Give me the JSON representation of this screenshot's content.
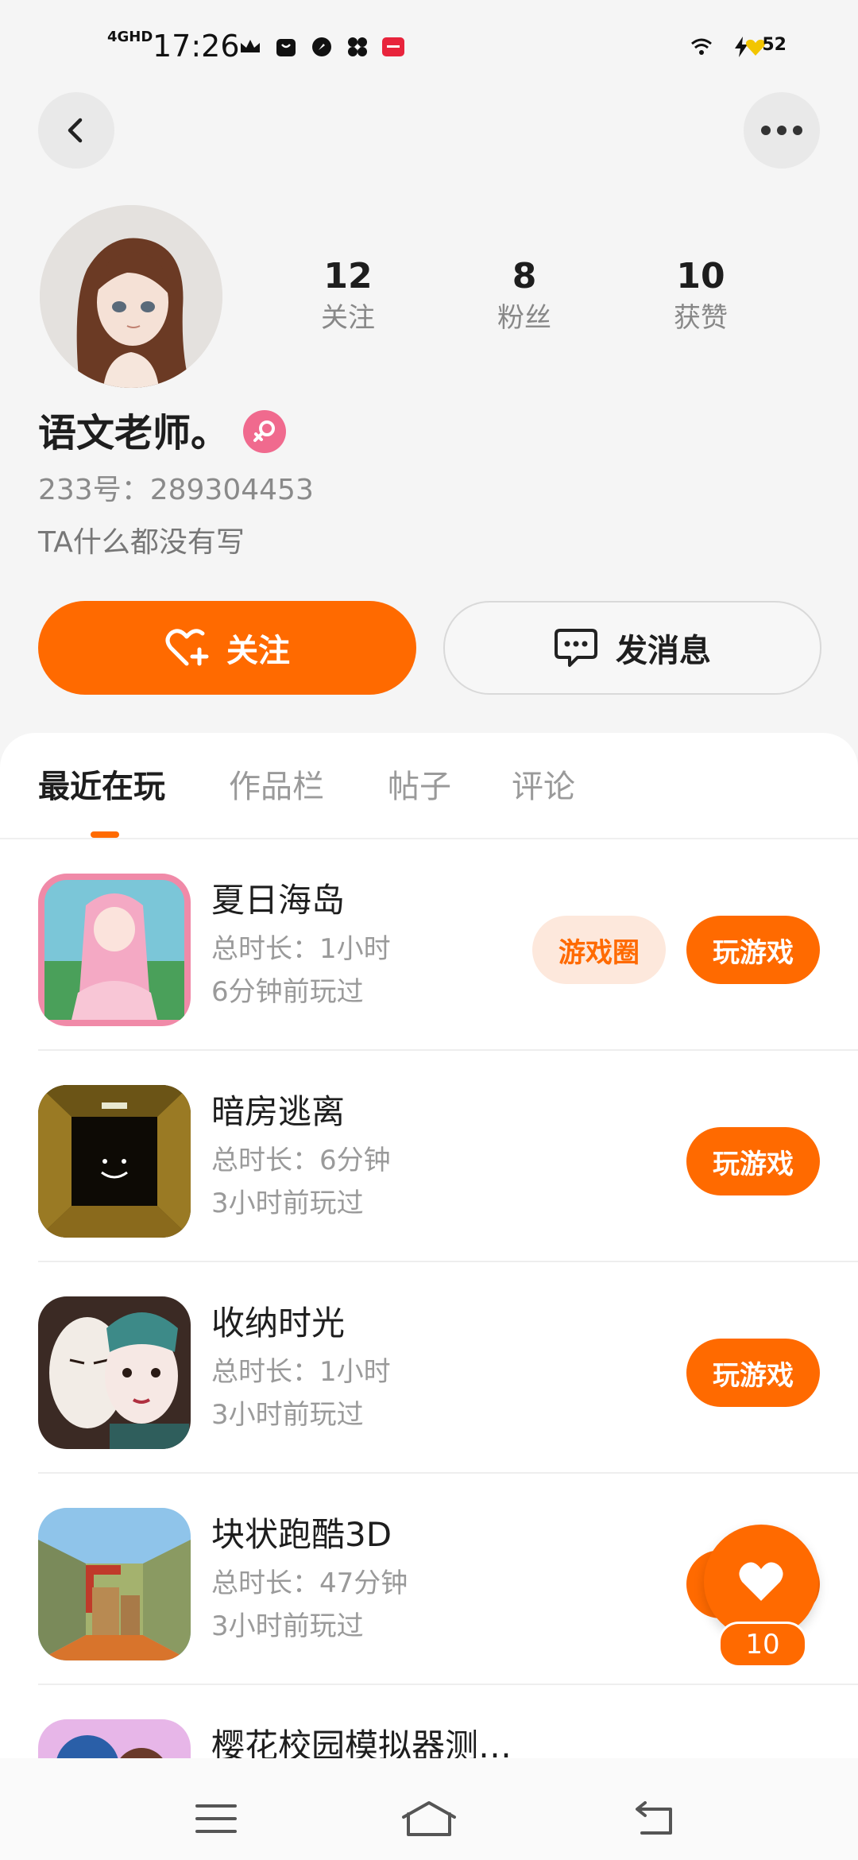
{
  "status_bar": {
    "network": "4GHD",
    "time": "17:26",
    "battery": "52"
  },
  "profile": {
    "name": "语文老师。",
    "uid": "233号：289304453",
    "bio": "TA什么都没有写",
    "stats": [
      {
        "value": "12",
        "label": "关注"
      },
      {
        "value": "8",
        "label": "粉丝"
      },
      {
        "value": "10",
        "label": "获赞"
      }
    ]
  },
  "actions": {
    "follow": "关注",
    "message": "发消息"
  },
  "tabs": [
    "最近在玩",
    "作品栏",
    "帖子",
    "评论"
  ],
  "games": [
    {
      "title": "夏日海岛",
      "duration": "总时长：1小时",
      "last_played": "6分钟前玩过",
      "circle": "游戏圈",
      "play": "玩游戏"
    },
    {
      "title": "暗房逃离",
      "duration": "总时长：6分钟",
      "last_played": "3小时前玩过",
      "play": "玩游戏"
    },
    {
      "title": "收纳时光",
      "duration": "总时长：1小时",
      "last_played": "3小时前玩过",
      "play": "玩游戏"
    },
    {
      "title": "块状跑酷3D",
      "duration": "总时长：47分钟",
      "last_played": "3小时前玩过",
      "play": "玩游戏"
    },
    {
      "title": "樱花校园模拟器测…"
    }
  ],
  "like_count": "10",
  "colors": {
    "accent": "#ff6a00",
    "gender": "#f06a8e"
  }
}
